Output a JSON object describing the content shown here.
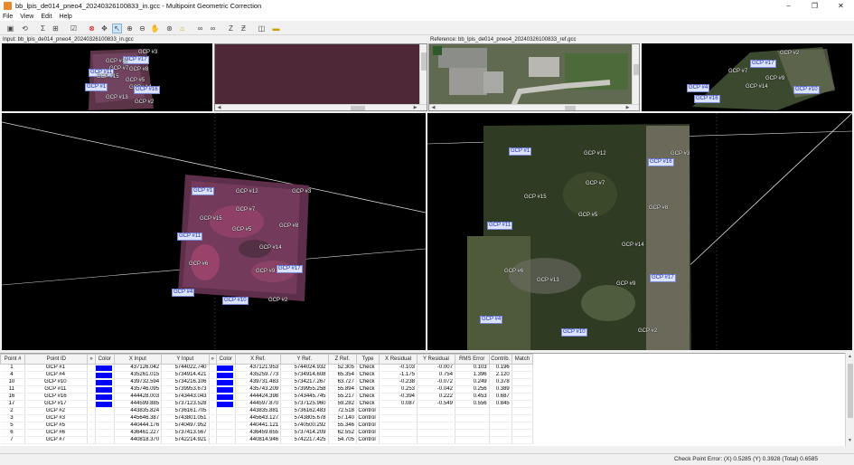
{
  "window": {
    "title": "bb_lpis_de014_pneo4_20240326100833_in.gcc - Multipoint Geometric Correction",
    "controls": [
      "–",
      "❐",
      "✕"
    ]
  },
  "menu": [
    "File",
    "View",
    "Edit",
    "Help"
  ],
  "panels": {
    "input_label": "Input: bb_lpis_de014_pneo4_20240326100833_in.gcc",
    "reference_label": "Reference: bb_lpis_de014_pneo4_20240326100833_ref.gcc"
  },
  "gcps": {
    "ov_in": [
      {
        "id": "GCP #17",
        "blue": true
      },
      {
        "id": "GCP #12",
        "blue": false
      },
      {
        "id": "GCP #7",
        "blue": false
      },
      {
        "id": "GCP #8",
        "blue": false
      },
      {
        "id": "GCP #11",
        "blue": true
      },
      {
        "id": "GCP #15",
        "blue": false
      },
      {
        "id": "GCP #5",
        "blue": false
      },
      {
        "id": "GCP #14",
        "blue": false
      },
      {
        "id": "GCP #1",
        "blue": true
      },
      {
        "id": "GCP #16",
        "blue": true
      },
      {
        "id": "GCP #13",
        "blue": false
      },
      {
        "id": "GCP #2",
        "blue": false
      },
      {
        "id": "GCP #3",
        "blue": false
      }
    ],
    "ov_ref": [
      {
        "id": "GCP #2",
        "blue": false
      },
      {
        "id": "GCP #17",
        "blue": true
      },
      {
        "id": "GCP #7",
        "blue": false
      },
      {
        "id": "GCP #9",
        "blue": false
      },
      {
        "id": "GCP #14",
        "blue": false
      },
      {
        "id": "GCP #10",
        "blue": true
      },
      {
        "id": "GCP #16",
        "blue": true
      },
      {
        "id": "GCP #4",
        "blue": true
      }
    ],
    "main_in": [
      {
        "id": "GCP #1",
        "blue": true
      },
      {
        "id": "GCP #12",
        "blue": false
      },
      {
        "id": "GCP #3",
        "blue": false
      },
      {
        "id": "GCP #7",
        "blue": false
      },
      {
        "id": "GCP #15",
        "blue": false
      },
      {
        "id": "GCP #5",
        "blue": false
      },
      {
        "id": "GCP #8",
        "blue": false
      },
      {
        "id": "GCP #11",
        "blue": true
      },
      {
        "id": "GCP #14",
        "blue": false
      },
      {
        "id": "GCP #6",
        "blue": false
      },
      {
        "id": "GCP #9",
        "blue": false
      },
      {
        "id": "GCP #17",
        "blue": true
      },
      {
        "id": "GCP #4",
        "blue": true
      },
      {
        "id": "GCP #2",
        "blue": false
      },
      {
        "id": "GCP #10",
        "blue": true
      }
    ],
    "main_ref": [
      {
        "id": "GCP #1",
        "blue": true
      },
      {
        "id": "GCP #12",
        "blue": false
      },
      {
        "id": "GCP #3",
        "blue": false
      },
      {
        "id": "GCP #16",
        "blue": true
      },
      {
        "id": "GCP #7",
        "blue": false
      },
      {
        "id": "GCP #15",
        "blue": false
      },
      {
        "id": "GCP #11",
        "blue": true
      },
      {
        "id": "GCP #5",
        "blue": false
      },
      {
        "id": "GCP #8",
        "blue": false
      },
      {
        "id": "GCP #14",
        "blue": false
      },
      {
        "id": "GCP #6",
        "blue": false
      },
      {
        "id": "GCP #13",
        "blue": false
      },
      {
        "id": "GCP #9",
        "blue": false
      },
      {
        "id": "GCP #17",
        "blue": true
      },
      {
        "id": "GCP #4",
        "blue": true
      },
      {
        "id": "GCP #10",
        "blue": true
      },
      {
        "id": "GCP #2",
        "blue": false
      }
    ]
  },
  "table": {
    "columns": [
      "Point #",
      "Point ID",
      "»",
      "Color",
      "X Input",
      "Y Input",
      "»",
      "Color",
      "X Ref.",
      "Y Ref.",
      "Z Ref.",
      "Type",
      "X Residual",
      "Y Residual",
      "RMS Error",
      "Contrib.",
      "Match"
    ],
    "rows": [
      {
        "num": "1",
        "id": "GCP #1",
        "color": "#0000ff",
        "xin": "437126.042",
        "yin": "5744022.740",
        "rcolor": "#0000ff",
        "xref": "437121.953",
        "yref": "5744024.932",
        "zref": "52.305",
        "type": "Check",
        "xres": "-0.103",
        "yres": "-0.007",
        "rms": "0.103",
        "contrib": "0.196",
        "match": ""
      },
      {
        "num": "4",
        "id": "GCP #4",
        "color": "#0000ff",
        "xin": "435261.015",
        "yin": "5734914.421",
        "rcolor": "#0000ff",
        "xref": "435259.773",
        "yref": "5734914.608",
        "zref": "65.354",
        "type": "Check",
        "xres": "-1.175",
        "yres": "0.754",
        "rms": "1.396",
        "contrib": "2.120",
        "match": ""
      },
      {
        "num": "10",
        "id": "GCP #10",
        "color": "#0000ff",
        "xin": "439732.594",
        "yin": "5734216.106",
        "rcolor": "#0000ff",
        "xref": "439731.483",
        "yref": "5734217.267",
        "zref": "63.727",
        "type": "Check",
        "xres": "-0.238",
        "yres": "-0.072",
        "rms": "0.249",
        "contrib": "0.378",
        "match": ""
      },
      {
        "num": "11",
        "id": "GCP #11",
        "color": "#0000ff",
        "xin": "435746.095",
        "yin": "5739953.673",
        "rcolor": "#0000ff",
        "xref": "435743.209",
        "yref": "5739955.258",
        "zref": "55.894",
        "type": "Check",
        "xres": "0.253",
        "yres": "-0.042",
        "rms": "0.256",
        "contrib": "0.389",
        "match": ""
      },
      {
        "num": "16",
        "id": "GCP #16",
        "color": "#0000ff",
        "xin": "444428.003",
        "yin": "5743443.043",
        "rcolor": "#0000ff",
        "xref": "444424.398",
        "yref": "5743445.745",
        "zref": "55.217",
        "type": "Check",
        "xres": "-0.394",
        "yres": "0.222",
        "rms": "0.453",
        "contrib": "0.687",
        "match": ""
      },
      {
        "num": "17",
        "id": "GCP #17",
        "color": "#0000ff",
        "xin": "444599.885",
        "yin": "5737123.528",
        "rcolor": "#0000ff",
        "xref": "444597.870",
        "yref": "5737125.960",
        "zref": "59.282",
        "type": "Check",
        "xres": "0.087",
        "yres": "-0.549",
        "rms": "0.556",
        "contrib": "0.845",
        "match": ""
      },
      {
        "num": "2",
        "id": "GCP #2",
        "color": "",
        "xin": "443835.824",
        "yin": "5736161.705",
        "rcolor": "",
        "xref": "443835.881",
        "yref": "5736162.483",
        "zref": "72.518",
        "type": "Control",
        "xres": "",
        "yres": "",
        "rms": "",
        "contrib": "",
        "match": ""
      },
      {
        "num": "3",
        "id": "GCP #3",
        "color": "",
        "xin": "445646.387",
        "yin": "5743801.051",
        "rcolor": "",
        "xref": "445643.127",
        "yref": "5743805.678",
        "zref": "57.140",
        "type": "Control",
        "xres": "",
        "yres": "",
        "rms": "",
        "contrib": "",
        "match": ""
      },
      {
        "num": "5",
        "id": "GCP #5",
        "color": "",
        "xin": "440444.176",
        "yin": "5740497.952",
        "rcolor": "",
        "xref": "440441.121",
        "yref": "5740500.292",
        "zref": "55.346",
        "type": "Control",
        "xres": "",
        "yres": "",
        "rms": "",
        "contrib": "",
        "match": ""
      },
      {
        "num": "6",
        "id": "GCP #6",
        "color": "",
        "xin": "436461.227",
        "yin": "5737413.567",
        "rcolor": "",
        "xref": "436459.655",
        "yref": "5737414.209",
        "zref": "62.552",
        "type": "Control",
        "xres": "",
        "yres": "",
        "rms": "",
        "contrib": "",
        "match": ""
      },
      {
        "num": "7",
        "id": "GCP #7",
        "color": "",
        "xin": "440818.370",
        "yin": "5742214.921",
        "rcolor": "",
        "xref": "440814.946",
        "yref": "5742217.425",
        "zref": "54.705",
        "type": "Control",
        "xres": "",
        "yres": "",
        "rms": "",
        "contrib": "",
        "match": ""
      }
    ]
  },
  "status": {
    "text": "Check Point Error: (X) 0.5285   (Y) 0.3928   (Total) 0.6585"
  },
  "colors": {
    "gcp_blue_bg": "#dbe3ff",
    "gcp_blue_text": "#1b2aa8",
    "check_swatch": "#0000ff"
  }
}
